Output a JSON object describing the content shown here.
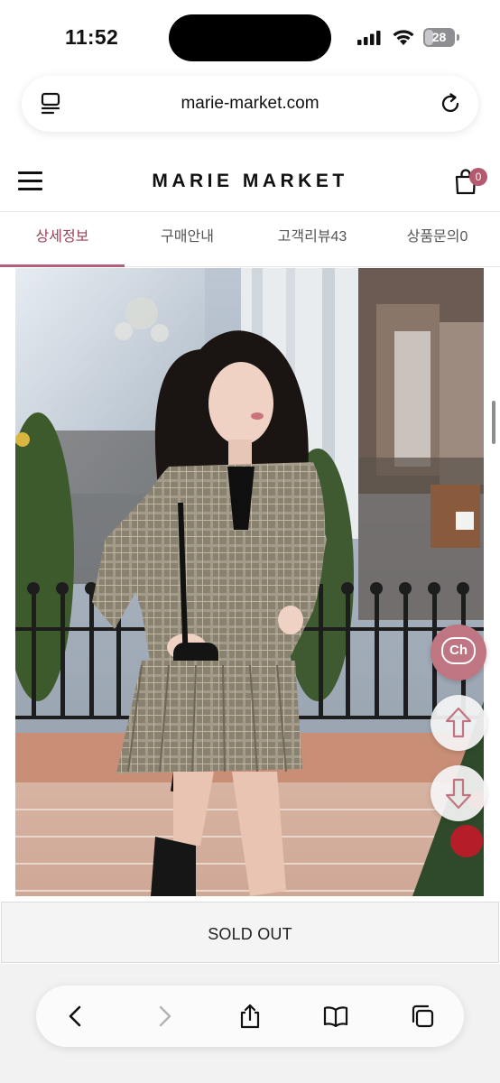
{
  "status_bar": {
    "time": "11:52",
    "battery": "28",
    "battery_level": 0.28
  },
  "browser": {
    "url": "marie-market.com"
  },
  "site": {
    "brand": "MARIE MARKET",
    "cart_count": "0"
  },
  "tabs": [
    {
      "label": "상세정보",
      "active": true
    },
    {
      "label": "구매안내",
      "active": false
    },
    {
      "label": "고객리뷰43",
      "active": false
    },
    {
      "label": "상품문의0",
      "active": false
    }
  ],
  "floating": {
    "chat_label": "Ch"
  },
  "purchase": {
    "sold_out_label": "SOLD OUT"
  },
  "colors": {
    "accent": "#b06078",
    "chat_button": "#c07583",
    "active_tab_text": "#9a3f55"
  },
  "icons": {
    "reader": "reader-icon",
    "reload": "reload-icon",
    "menu": "hamburger-menu-icon",
    "bag": "shopping-bag-icon",
    "up": "arrow-up-icon",
    "down": "arrow-down-icon",
    "back": "chevron-left-icon",
    "forward": "chevron-right-icon",
    "share": "share-icon",
    "bookmarks": "book-icon",
    "tabs": "tabs-icon"
  }
}
